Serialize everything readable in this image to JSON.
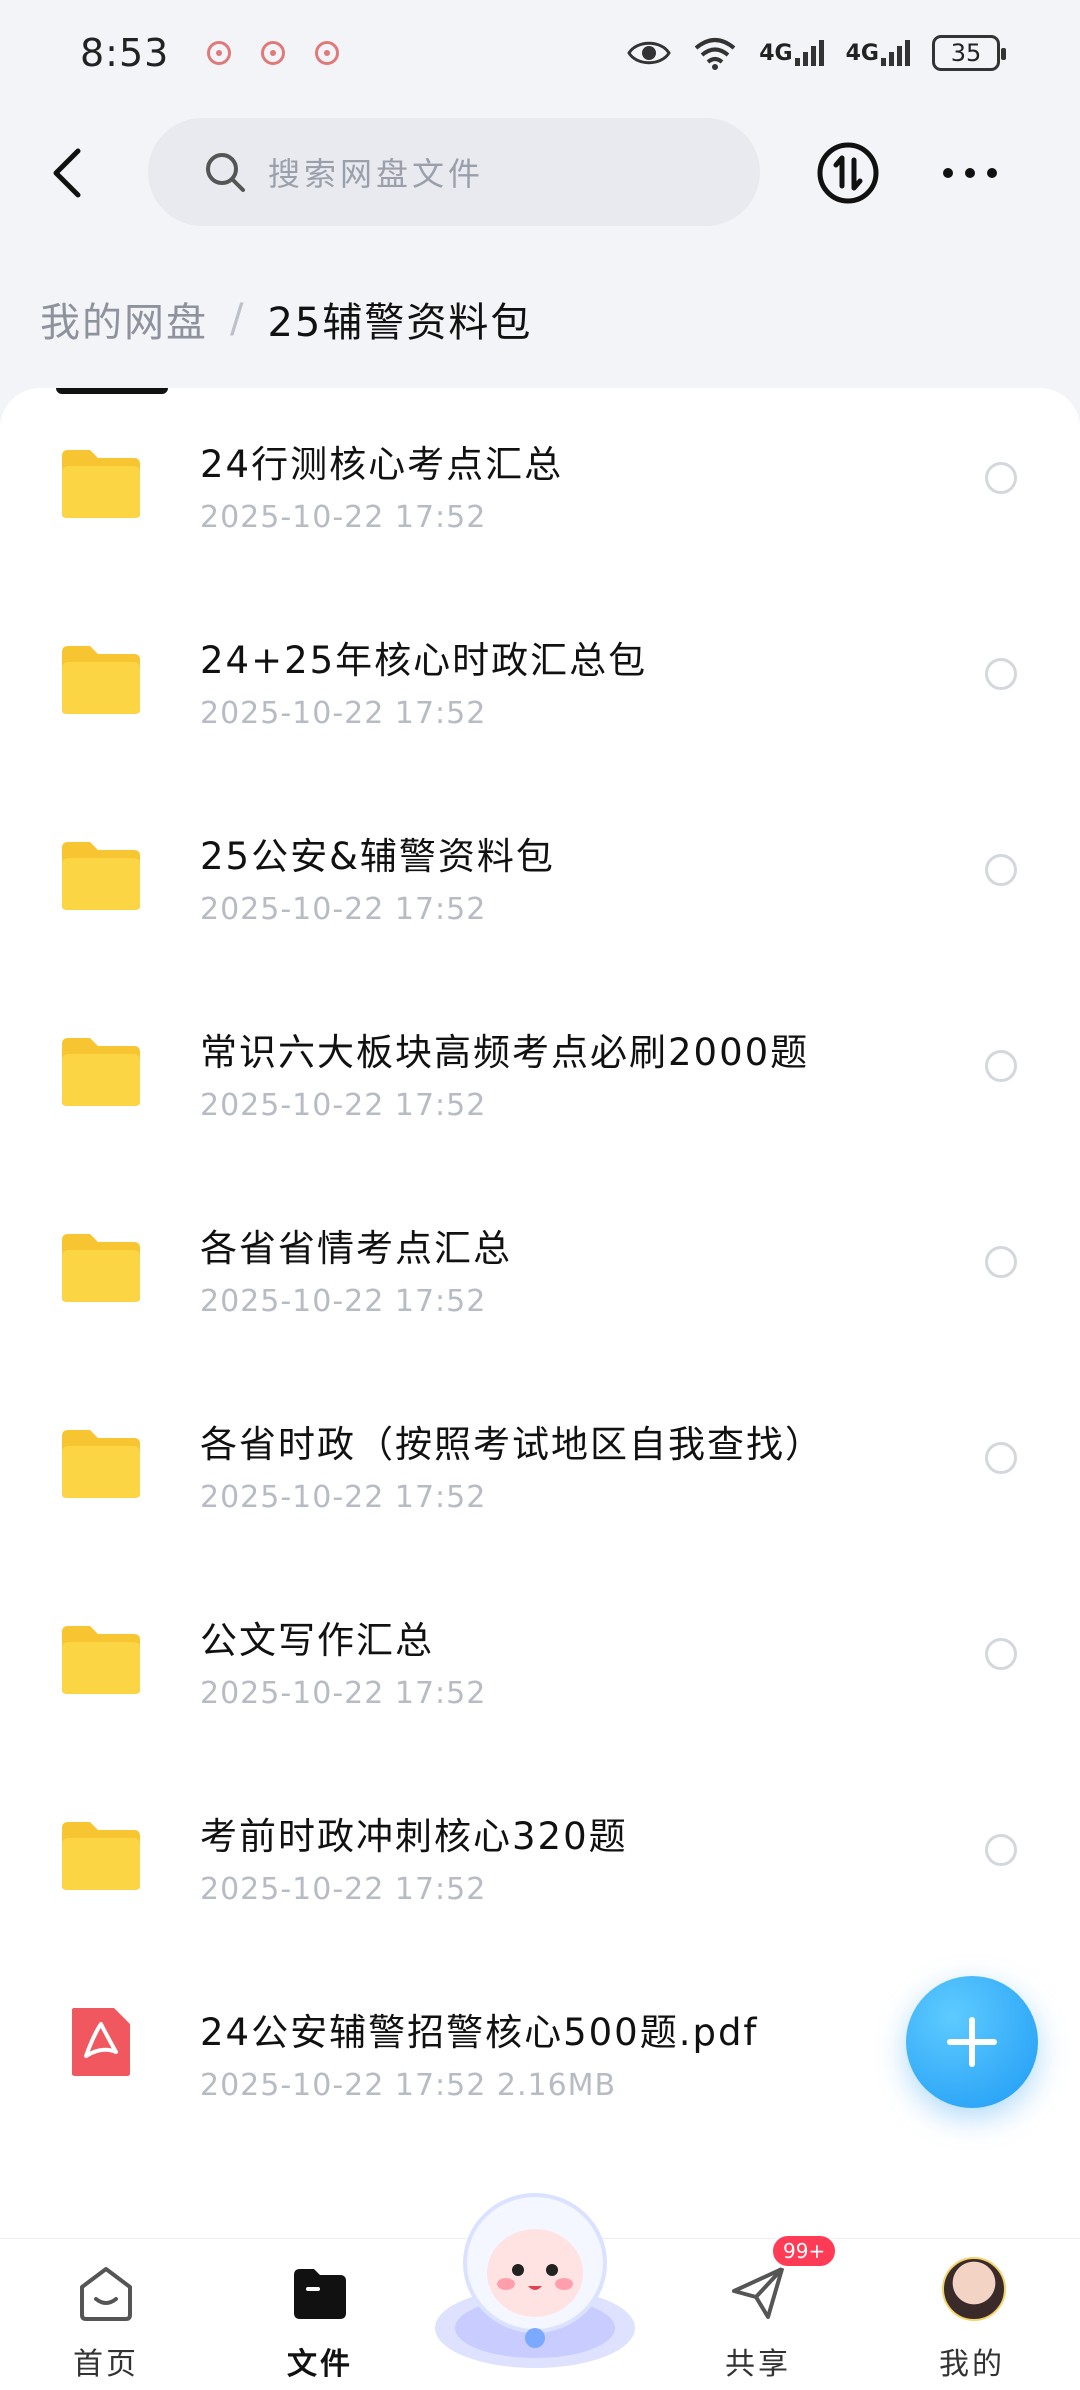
{
  "status": {
    "time": "8:53",
    "signal1": "4G",
    "signal2": "4G",
    "battery": "35"
  },
  "header": {
    "search_placeholder": "搜索网盘文件"
  },
  "breadcrumb": {
    "root": "我的网盘",
    "separator": "/",
    "current": "25辅警资料包"
  },
  "files": [
    {
      "name": "24行测核心考点汇总",
      "meta": "2025-10-22  17:52",
      "type": "folder"
    },
    {
      "name": "24+25年核心时政汇总包",
      "meta": "2025-10-22  17:52",
      "type": "folder"
    },
    {
      "name": "25公安&辅警资料包",
      "meta": "2025-10-22  17:52",
      "type": "folder"
    },
    {
      "name": "常识六大板块高频考点必刷2000题",
      "meta": "2025-10-22  17:52",
      "type": "folder"
    },
    {
      "name": "各省省情考点汇总",
      "meta": "2025-10-22  17:52",
      "type": "folder"
    },
    {
      "name": "各省时政（按照考试地区自我查找）",
      "meta": "2025-10-22  17:52",
      "type": "folder"
    },
    {
      "name": "公文写作汇总",
      "meta": "2025-10-22  17:52",
      "type": "folder"
    },
    {
      "name": "考前时政冲刺核心320题",
      "meta": "2025-10-22  17:52",
      "type": "folder"
    },
    {
      "name": "24公安辅警招警核心500题.pdf",
      "meta": "2025-10-22  17:52   2.16MB",
      "type": "pdf"
    }
  ],
  "nav": {
    "home": "首页",
    "files": "文件",
    "share": "共享",
    "share_badge": "99+",
    "mine": "我的"
  },
  "colors": {
    "accent": "#1f9bf5",
    "folder": "#f7c531",
    "pdf": "#f0575f",
    "badge": "#ff3b55"
  }
}
